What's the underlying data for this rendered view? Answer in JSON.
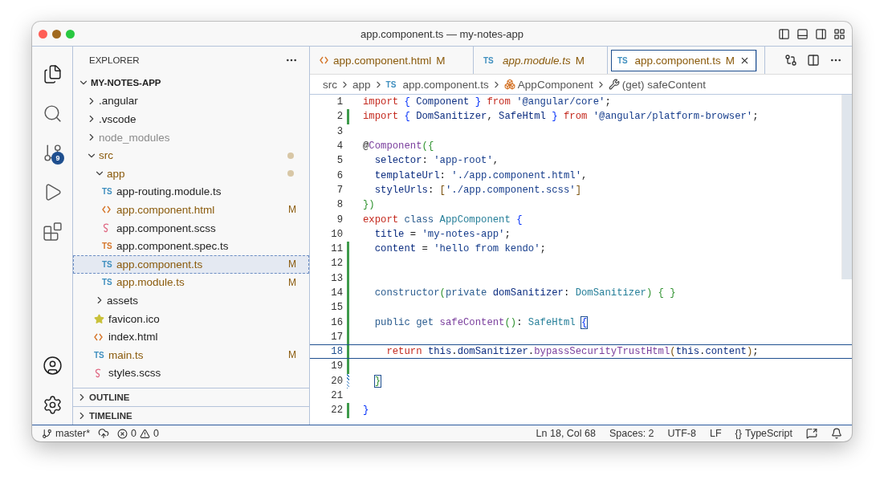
{
  "window": {
    "title": "app.component.ts — my-notes-app"
  },
  "activity_bar": {
    "top": [
      {
        "kind": "explorer",
        "selected": true
      },
      {
        "kind": "search",
        "selected": false
      },
      {
        "kind": "source-control",
        "selected": false,
        "badge": "9"
      },
      {
        "kind": "run-debug",
        "selected": false
      },
      {
        "kind": "extensions",
        "selected": false
      }
    ],
    "bottom": [
      {
        "kind": "account"
      },
      {
        "kind": "settings"
      }
    ]
  },
  "sidebar": {
    "title": "EXPLORER",
    "tree": {
      "name": "MY-NOTES-APP",
      "kind": "root",
      "expanded": true,
      "children": [
        {
          "name": ".angular",
          "kind": "folder",
          "expanded": false
        },
        {
          "name": ".vscode",
          "kind": "folder",
          "expanded": false
        },
        {
          "name": "node_modules",
          "kind": "folder",
          "expanded": false,
          "ignored": true
        },
        {
          "name": "src",
          "kind": "folder",
          "expanded": true,
          "modified": true,
          "children": [
            {
              "name": "app",
              "kind": "folder",
              "expanded": true,
              "modified": true,
              "children": [
                {
                  "name": "app-routing.module.ts",
                  "kind": "ts",
                  "glyph": "TS",
                  "modified": false,
                  "selected": false
                },
                {
                  "name": "app.component.html",
                  "kind": "html",
                  "modified": true,
                  "decoration": "M",
                  "selected": false
                },
                {
                  "name": "app.component.scss",
                  "kind": "scss",
                  "modified": false,
                  "selected": false
                },
                {
                  "name": "app.component.spec.ts",
                  "kind": "spec",
                  "glyph": "TS",
                  "modified": false,
                  "selected": false
                },
                {
                  "name": "app.component.ts",
                  "kind": "ts",
                  "glyph": "TS",
                  "modified": true,
                  "decoration": "M",
                  "selected": true
                },
                {
                  "name": "app.module.ts",
                  "kind": "ts",
                  "glyph": "TS",
                  "modified": true,
                  "decoration": "M",
                  "selected": false
                }
              ]
            },
            {
              "name": "assets",
              "kind": "folder",
              "expanded": false
            },
            {
              "name": "favicon.ico",
              "kind": "star",
              "modified": false,
              "selected": false
            },
            {
              "name": "index.html",
              "kind": "html",
              "modified": false,
              "selected": false
            },
            {
              "name": "main.ts",
              "kind": "ts",
              "glyph": "TS",
              "modified": true,
              "decoration": "M",
              "selected": false
            },
            {
              "name": "styles.scss",
              "kind": "scss",
              "modified": false,
              "selected": false
            }
          ]
        }
      ]
    },
    "sections": [
      {
        "title": "OUTLINE",
        "expanded": false
      },
      {
        "title": "TIMELINE",
        "expanded": false
      }
    ]
  },
  "tabs": [
    {
      "label": "app.component.html",
      "kind": "html",
      "badge": "M",
      "preview": false,
      "selected": false
    },
    {
      "label": "app.module.ts",
      "kind": "ts",
      "glyph": "TS",
      "badge": "M",
      "preview": true,
      "selected": false
    },
    {
      "label": "app.component.ts",
      "kind": "ts",
      "glyph": "TS",
      "badge": "M",
      "preview": false,
      "selected": true
    }
  ],
  "breadcrumbs": [
    {
      "text": "src",
      "kind": "folder"
    },
    {
      "text": "app",
      "kind": "folder"
    },
    {
      "text": "app.component.ts",
      "kind": "ts",
      "glyph": "TS"
    },
    {
      "text": "AppComponent",
      "kind": "class"
    },
    {
      "text": "(get) safeContent",
      "kind": "getter"
    }
  ],
  "editor": {
    "lines": [
      {
        "n": "1",
        "current": false,
        "kind": "unchanged",
        "tokens": [
          {
            "text": "import ",
            "kind": "kw"
          },
          {
            "text": "{ ",
            "kind": "b1"
          },
          {
            "text": "Component ",
            "kind": "var"
          },
          {
            "text": "} ",
            "kind": "b1"
          },
          {
            "text": "from ",
            "kind": "kw"
          },
          {
            "text": "'@angular/core'",
            "kind": "str"
          },
          {
            "text": ";",
            "kind": "p"
          }
        ]
      },
      {
        "n": "2",
        "current": false,
        "kind": "added",
        "tokens": [
          {
            "text": "import ",
            "kind": "kw"
          },
          {
            "text": "{ ",
            "kind": "b1"
          },
          {
            "text": "DomSanitizer",
            "kind": "var"
          },
          {
            "text": ", ",
            "kind": "p"
          },
          {
            "text": "SafeHtml ",
            "kind": "var"
          },
          {
            "text": "} ",
            "kind": "b1"
          },
          {
            "text": "from ",
            "kind": "kw"
          },
          {
            "text": "'@angular/platform-browser'",
            "kind": "str"
          },
          {
            "text": ";",
            "kind": "p"
          }
        ]
      },
      {
        "n": "3",
        "current": false,
        "kind": "unchanged"
      },
      {
        "n": "4",
        "current": false,
        "kind": "unchanged",
        "tokens": [
          {
            "text": "@",
            "kind": "p"
          },
          {
            "text": "Component",
            "kind": "fn"
          },
          {
            "text": "({",
            "kind": "b2"
          }
        ]
      },
      {
        "n": "5",
        "current": false,
        "kind": "unchanged",
        "tokens": [
          {
            "text": "  selector",
            "kind": "var"
          },
          {
            "text": ": ",
            "kind": "p"
          },
          {
            "text": "'app-root'",
            "kind": "str"
          },
          {
            "text": ",",
            "kind": "p"
          }
        ]
      },
      {
        "n": "6",
        "current": false,
        "kind": "unchanged",
        "tokens": [
          {
            "text": "  templateUrl",
            "kind": "var"
          },
          {
            "text": ": ",
            "kind": "p"
          },
          {
            "text": "'./app.component.html'",
            "kind": "str"
          },
          {
            "text": ",",
            "kind": "p"
          }
        ]
      },
      {
        "n": "7",
        "current": false,
        "kind": "unchanged",
        "tokens": [
          {
            "text": "  styleUrls",
            "kind": "var"
          },
          {
            "text": ": ",
            "kind": "p"
          },
          {
            "text": "[",
            "kind": "b3"
          },
          {
            "text": "'./app.component.scss'",
            "kind": "str"
          },
          {
            "text": "]",
            "kind": "b3"
          }
        ]
      },
      {
        "n": "8",
        "current": false,
        "kind": "unchanged",
        "tokens": [
          {
            "text": "})",
            "kind": "b2"
          }
        ]
      },
      {
        "n": "9",
        "current": false,
        "kind": "unchanged",
        "tokens": [
          {
            "text": "export ",
            "kind": "kw"
          },
          {
            "text": "class ",
            "kind": "st"
          },
          {
            "text": "AppComponent ",
            "kind": "type"
          },
          {
            "text": "{",
            "kind": "b1"
          }
        ]
      },
      {
        "n": "10",
        "current": false,
        "kind": "unchanged",
        "tokens": [
          {
            "text": "  title ",
            "kind": "var"
          },
          {
            "text": "= ",
            "kind": "p"
          },
          {
            "text": "'my-notes-app'",
            "kind": "str"
          },
          {
            "text": ";",
            "kind": "p"
          }
        ]
      },
      {
        "n": "11",
        "current": false,
        "kind": "added",
        "tokens": [
          {
            "text": "  content ",
            "kind": "var"
          },
          {
            "text": "= ",
            "kind": "p"
          },
          {
            "text": "'hello from kendo'",
            "kind": "str"
          },
          {
            "text": ";",
            "kind": "p"
          }
        ]
      },
      {
        "n": "12",
        "current": false,
        "kind": "added"
      },
      {
        "n": "13",
        "current": false,
        "kind": "added"
      },
      {
        "n": "14",
        "current": false,
        "kind": "added",
        "tokens": [
          {
            "text": "  constructor",
            "kind": "st"
          },
          {
            "text": "(",
            "kind": "b2"
          },
          {
            "text": "private ",
            "kind": "st"
          },
          {
            "text": "domSanitizer",
            "kind": "var"
          },
          {
            "text": ": ",
            "kind": "p"
          },
          {
            "text": "DomSanitizer",
            "kind": "type"
          },
          {
            "text": ") ",
            "kind": "b2"
          },
          {
            "text": "{ }",
            "kind": "b2"
          }
        ]
      },
      {
        "n": "15",
        "current": false,
        "kind": "added"
      },
      {
        "n": "16",
        "current": false,
        "kind": "added",
        "tokens": [
          {
            "text": "  public get ",
            "kind": "st"
          },
          {
            "text": "safeContent",
            "kind": "fn"
          },
          {
            "text": "()",
            "kind": "b2"
          },
          {
            "text": ": ",
            "kind": "p"
          },
          {
            "text": "SafeHtml ",
            "kind": "type"
          },
          {
            "text": "{",
            "kind": "b1",
            "matched": true
          }
        ]
      },
      {
        "n": "17",
        "current": false,
        "kind": "added"
      },
      {
        "n": "18",
        "current": true,
        "kind": "added",
        "tokens": [
          {
            "text": "    return ",
            "kind": "kw"
          },
          {
            "text": "this",
            "kind": "var"
          },
          {
            "text": ".",
            "kind": "p"
          },
          {
            "text": "domSanitizer",
            "kind": "var"
          },
          {
            "text": ".",
            "kind": "p"
          },
          {
            "text": "bypassSecurityTrustHtml",
            "kind": "fn"
          },
          {
            "text": "(",
            "kind": "b3"
          },
          {
            "text": "this",
            "kind": "var"
          },
          {
            "text": ".",
            "kind": "p"
          },
          {
            "text": "content",
            "kind": "var"
          },
          {
            "text": ")",
            "kind": "b3"
          },
          {
            "text": ";",
            "kind": "p"
          }
        ]
      },
      {
        "n": "19",
        "current": false,
        "kind": "added"
      },
      {
        "n": "20",
        "current": false,
        "kind": "modified",
        "tokens": [
          {
            "text": "  }",
            "kind": "b2",
            "matched": true
          }
        ]
      },
      {
        "n": "21",
        "current": false,
        "kind": "unchanged"
      },
      {
        "n": "22",
        "current": false,
        "kind": "added",
        "tokens": [
          {
            "text": "}",
            "kind": "b1"
          }
        ]
      }
    ]
  },
  "status_bar": {
    "branch": "master*",
    "errors": "0",
    "warnings": "0",
    "right": [
      {
        "text": "Ln 18, Col 68"
      },
      {
        "text": "Spaces: 2"
      },
      {
        "text": "UTF-8"
      },
      {
        "text": "LF"
      },
      {
        "text": "TypeScript",
        "glyph": "{}"
      }
    ]
  }
}
